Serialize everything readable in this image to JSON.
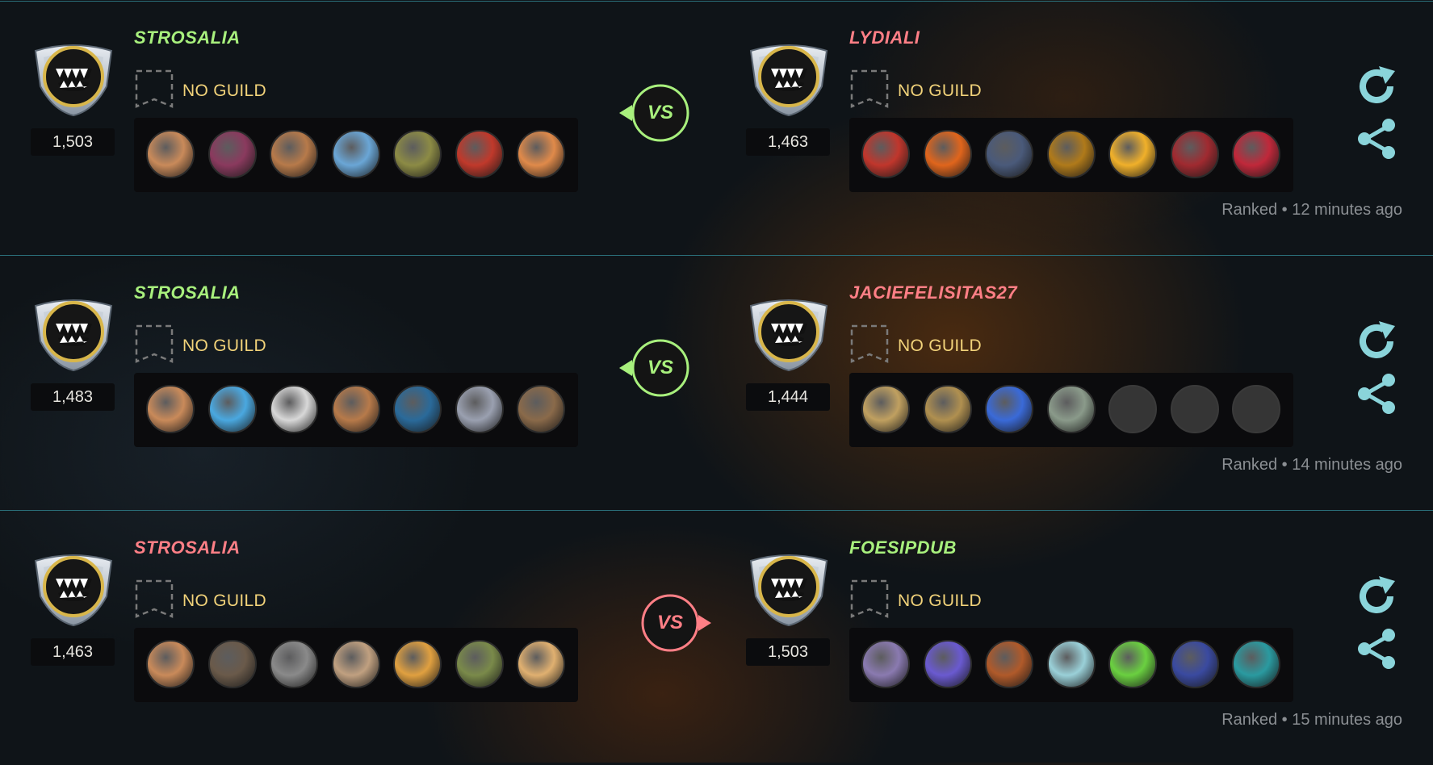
{
  "colors": {
    "win": "#a8f07d",
    "lose": "#ff7f86",
    "guild": "#f2d37a",
    "action": "#8ad4da"
  },
  "battles": [
    {
      "left": {
        "name": "STROSALIA",
        "result": "win",
        "rating": "1,503",
        "guild": "NO GUILD",
        "units": [
          "#c98a5a",
          "#8a3a5e",
          "#b77a4a",
          "#6aa6d6",
          "#8c8b45",
          "#c0392b",
          "#e08a4a"
        ]
      },
      "vs": {
        "label": "VS",
        "winner": "left"
      },
      "right": {
        "name": "LYDIALI",
        "result": "lose",
        "rating": "1,463",
        "guild": "NO GUILD",
        "units": [
          "#c0362c",
          "#e0651c",
          "#4a5a7a",
          "#b07a1a",
          "#f0b02a",
          "#a02a30",
          "#c0283a"
        ]
      },
      "meta": "Ranked • 12 minutes ago"
    },
    {
      "left": {
        "name": "STROSALIA",
        "result": "win",
        "rating": "1,483",
        "guild": "NO GUILD",
        "units": [
          "#c98a5a",
          "#4aa8e0",
          "#d8d8d8",
          "#b77a4a",
          "#2a6a9a",
          "#9aa0b0",
          "#8a6a4a"
        ]
      },
      "vs": {
        "label": "VS",
        "winner": "left"
      },
      "right": {
        "name": "JACIEFELISITAS27",
        "result": "lose",
        "rating": "1,444",
        "guild": "NO GUILD",
        "units": [
          "#c0a060",
          "#b09050",
          "#3a6ad8",
          "#8a9a8a",
          "",
          "",
          ""
        ]
      },
      "meta": "Ranked • 14 minutes ago"
    },
    {
      "left": {
        "name": "STROSALIA",
        "result": "lose",
        "rating": "1,463",
        "guild": "NO GUILD",
        "units": [
          "#c98a5a",
          "#6a5a4a",
          "#8a8a8a",
          "#c0a080",
          "#e0a040",
          "#7a8a4a",
          "#e0b070"
        ]
      },
      "vs": {
        "label": "VS",
        "winner": "right"
      },
      "right": {
        "name": "FOESIPDUB",
        "result": "win",
        "rating": "1,503",
        "guild": "NO GUILD",
        "units": [
          "#8a7ab0",
          "#6a5ad0",
          "#b05a2a",
          "#9ad0d8",
          "#6ad040",
          "#3a4aa0",
          "#2a9aa0"
        ]
      },
      "meta": "Ranked • 15 minutes ago"
    }
  ]
}
